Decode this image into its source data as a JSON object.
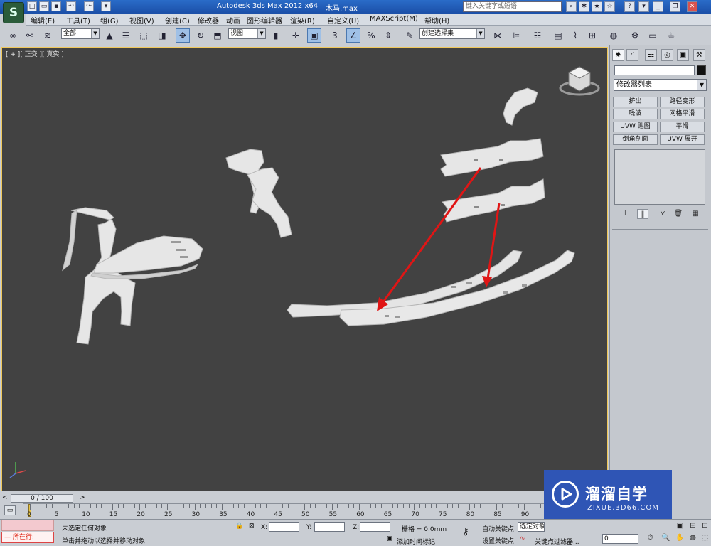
{
  "app": {
    "title": "Autodesk 3ds Max  2012 x64",
    "file": "木马.max",
    "logo": "S",
    "search_placeholder": "键入关键字或短语"
  },
  "menu": [
    "编辑(E)",
    "工具(T)",
    "组(G)",
    "视图(V)",
    "创建(C)",
    "修改器",
    "动画",
    "图形编辑器",
    "渲染(R)",
    "自定义(U)",
    "MAXScript(M)",
    "帮助(H)"
  ],
  "toolbar": {
    "selection_filter": "全部",
    "ref_coord": "视图",
    "named_selection": "创建选择集",
    "snap_label": "3",
    "percent_snap": "%"
  },
  "viewport": {
    "label": "[ + ][ 正交 ][ 真实 ]"
  },
  "cmd_panel": {
    "modifier_list": "修改器列表",
    "modifier_buttons": [
      "挤出",
      "路径变形",
      "噪波",
      "网格平滑",
      "UVW 贴图",
      "平滑",
      "倒角剖面",
      "UVW 展开"
    ]
  },
  "timeline": {
    "frame": "0 / 100",
    "ticks": [
      "0",
      "5",
      "10",
      "15",
      "20",
      "25",
      "30",
      "35",
      "40",
      "45",
      "50",
      "55",
      "60",
      "65",
      "70",
      "75",
      "80",
      "85",
      "90"
    ]
  },
  "status": {
    "selection": "未选定任何对象",
    "prompt": "单击并拖动以选择并移动对象",
    "x_label": "X:",
    "y_label": "Y:",
    "z_label": "Z:",
    "grid": "栅格 = 0.0mm",
    "add_time_tag": "添加时间标记",
    "auto_key": "自动关键点",
    "selected_objects": "选定对象",
    "set_key": "设置关键点",
    "key_filters": "关键点过滤器...",
    "running": "所在行:",
    "frame_value": "0"
  },
  "watermark": {
    "title": "溜溜自学",
    "url": "ZIXUE.3D66.COM"
  },
  "colors": {
    "viewport_bg": "#424242",
    "active_border": "#f0c85a",
    "arrow": "#e01515",
    "watermark": "#2f55b5"
  }
}
